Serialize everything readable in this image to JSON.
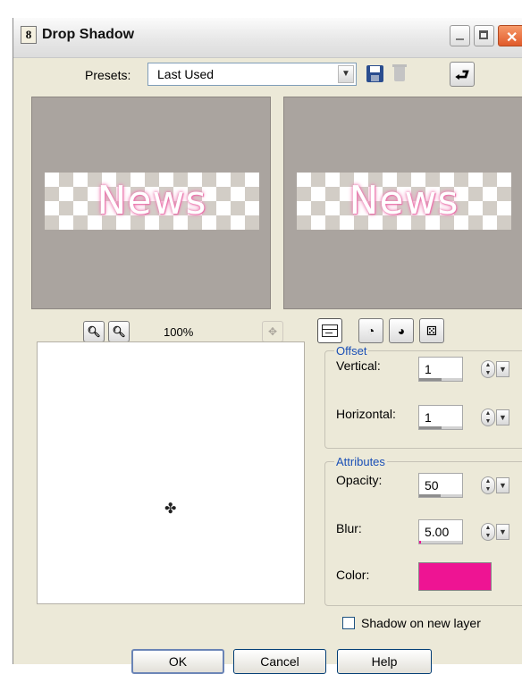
{
  "window": {
    "title": "Drop Shadow",
    "app_icon_glyph": "8"
  },
  "presets": {
    "label": "Presets:",
    "value": "Last Used"
  },
  "preview": {
    "text": "News",
    "zoom_level": "100%"
  },
  "offset": {
    "legend": "Offset",
    "vertical_label": "Vertical:",
    "vertical_value": "1",
    "horizontal_label": "Horizontal:",
    "horizontal_value": "1"
  },
  "attributes": {
    "legend": "Attributes",
    "opacity_label": "Opacity:",
    "opacity_value": "50",
    "blur_label": "Blur:",
    "blur_value": "5.00",
    "color_label": "Color:",
    "color_hex": "#ee1493"
  },
  "shadow_new_layer": {
    "label": "Shadow on new layer",
    "checked": false
  },
  "buttons": {
    "ok": "OK",
    "cancel": "Cancel",
    "help": "Help"
  },
  "colors": {
    "dialog_bg": "#ece9d8",
    "preview_bg": "#aaa49f",
    "legend_text": "#1a4fb6",
    "shadow_pink": "#e86aa6"
  }
}
